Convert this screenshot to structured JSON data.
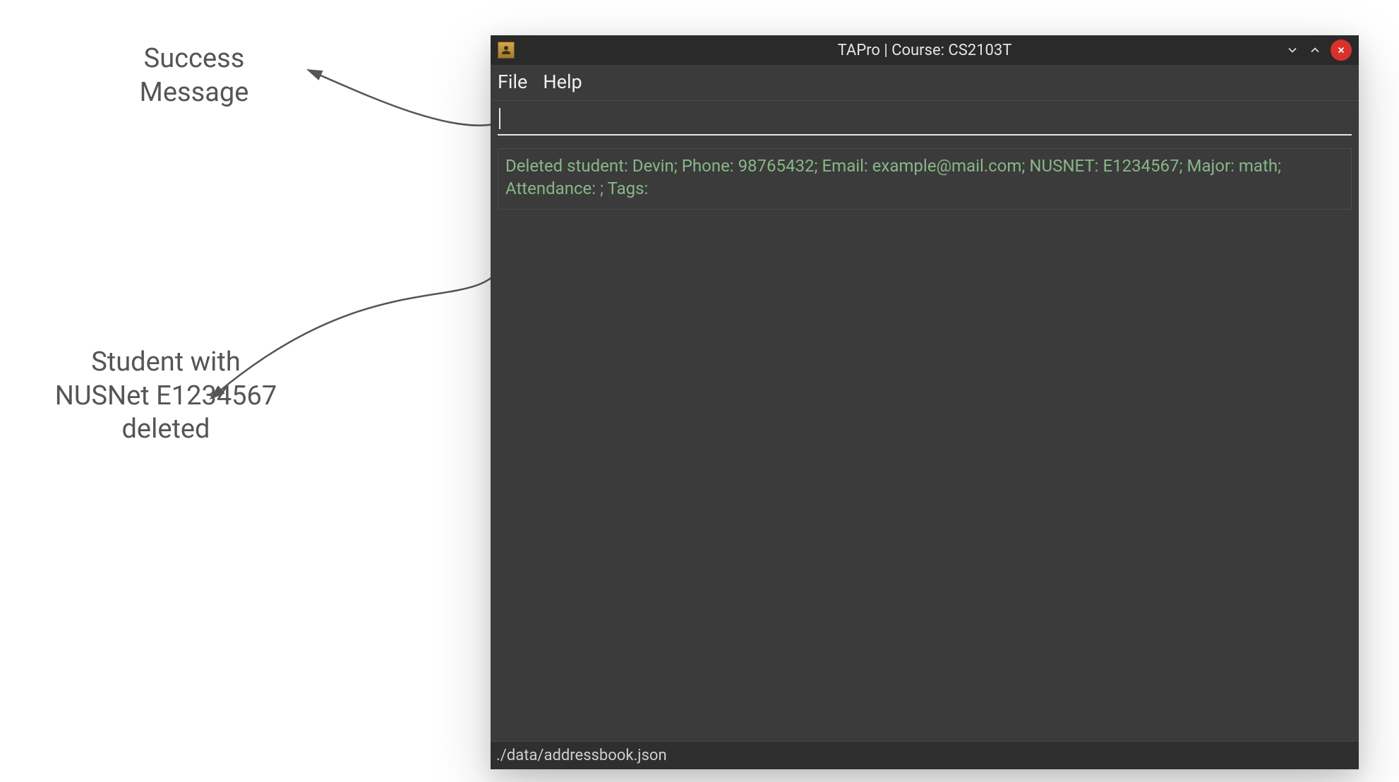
{
  "annotations": {
    "success_label_line1": "Success",
    "success_label_line2": "Message",
    "deleted_label_line1": "Student with",
    "deleted_label_line2": "NUSNet E1234567",
    "deleted_label_line3": "deleted"
  },
  "window": {
    "title": "TAPro | Course: CS2103T"
  },
  "menu": {
    "file": "File",
    "help": "Help"
  },
  "command_input": {
    "value": "",
    "placeholder": ""
  },
  "result": {
    "message": "Deleted student: Devin; Phone: 98765432; Email: example@mail.com; NUSNET: E1234567; Major: math; Attendance: ; Tags:"
  },
  "status_bar": {
    "path": "./data/addressbook.json"
  }
}
